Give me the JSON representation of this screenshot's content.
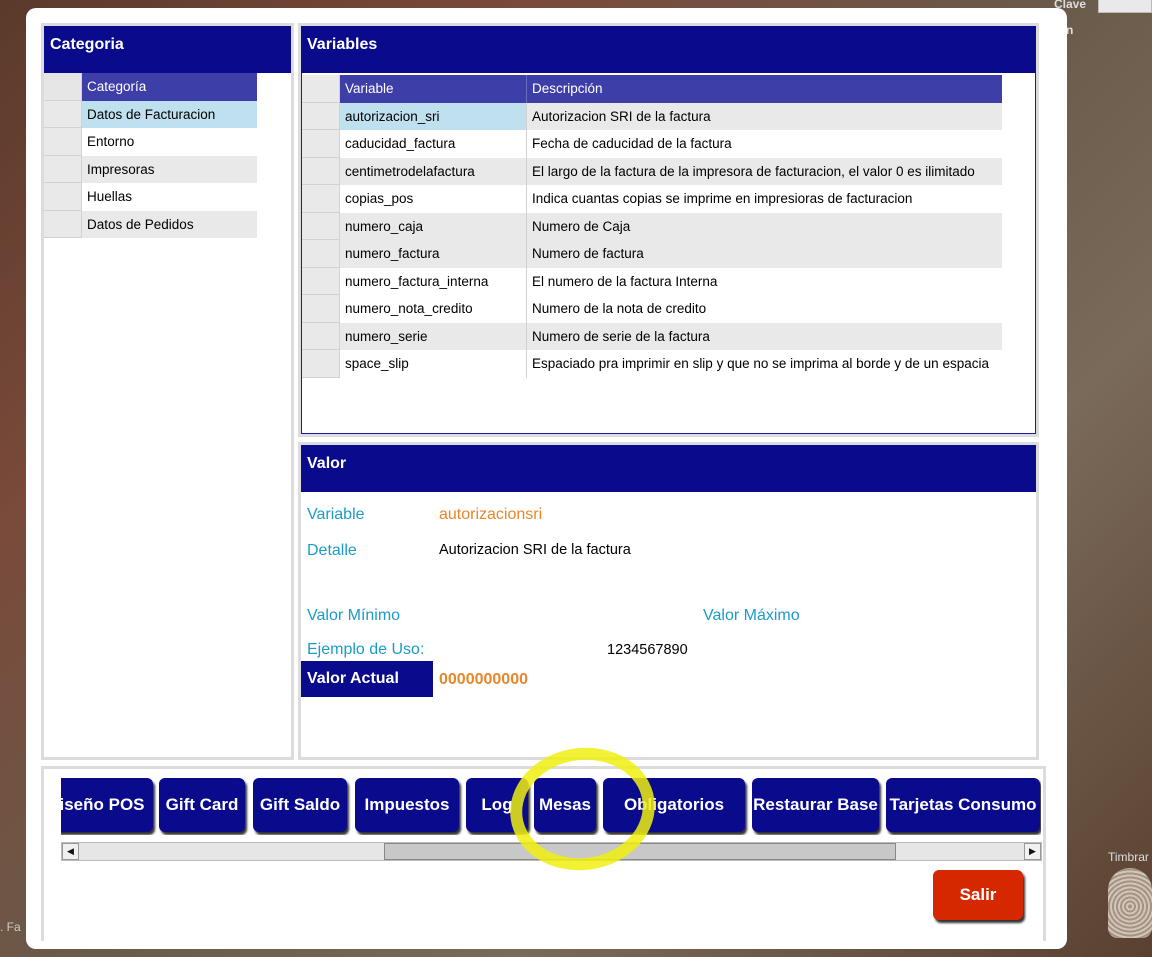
{
  "background": {
    "clave_label": "Clave",
    "n_label": "n",
    "timbrar_label": "Timbrar",
    "fa_label": ". Fa"
  },
  "categoria": {
    "title": "Categoria",
    "header": "Categoría",
    "items": [
      "Datos de Facturacion",
      "Entorno",
      "Impresoras",
      "Huellas",
      "Datos de Pedidos"
    ]
  },
  "variables": {
    "title": "Variables",
    "columns": [
      "Variable",
      "Descripción"
    ],
    "rows": [
      {
        "variable": "autorizacion_sri",
        "descripcion": "Autorizacion SRI de la factura"
      },
      {
        "variable": "caducidad_factura",
        "descripcion": "Fecha de caducidad de la factura"
      },
      {
        "variable": "centimetrodelafactura",
        "descripcion": "El largo de la factura de la impresora de facturacion, el valor 0 es ilimitado"
      },
      {
        "variable": "copias_pos",
        "descripcion": "Indica cuantas copias se imprime en impresioras de facturacion"
      },
      {
        "variable": "numero_caja",
        "descripcion": "Numero de Caja"
      },
      {
        "variable": "numero_factura",
        "descripcion": "Numero de factura"
      },
      {
        "variable": "numero_factura_interna",
        "descripcion": "El numero de la factura Interna"
      },
      {
        "variable": "numero_nota_credito",
        "descripcion": "Numero de la nota de credito"
      },
      {
        "variable": "numero_serie",
        "descripcion": "Numero de serie de la factura"
      },
      {
        "variable": "space_slip",
        "descripcion": "Espaciado pra imprimir en slip y que no se imprima al borde y de un espacia"
      }
    ]
  },
  "valor": {
    "title": "Valor",
    "variable_label": "Variable",
    "variable_value": "autorizacionsri",
    "detalle_label": "Detalle",
    "detalle_value": "Autorizacion SRI de la factura",
    "min_label": "Valor Mínimo",
    "max_label": "Valor Máximo",
    "ejemplo_label": "Ejemplo de Uso:",
    "ejemplo_value": "1234567890",
    "actual_label": "Valor Actual",
    "actual_value": "0000000000"
  },
  "buttons": {
    "diseno_pos": "iseño POS",
    "gift_card": "Gift Card",
    "gift_saldo": "Gift Saldo",
    "impuestos": "Impuestos",
    "log": "Log",
    "mesas": "Mesas",
    "obligatorios": "Obligatorios",
    "restaurar_base": "Restaurar Base",
    "tarjetas_consumo": "Tarjetas Consumo",
    "salir": "Salir"
  },
  "scrollbar": {
    "left_arrow": "◀",
    "right_arrow": "▶"
  },
  "colors": {
    "header_blue": "#0a0a8c",
    "accent_cyan": "#1a9cc8",
    "accent_orange": "#e8862a",
    "salir_red": "#d62800",
    "highlight_yellow": "#f0ee10"
  }
}
